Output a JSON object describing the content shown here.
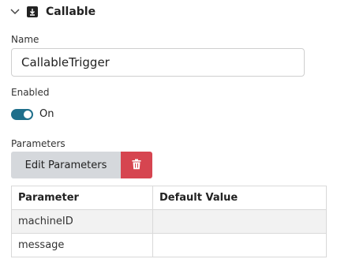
{
  "header": {
    "title": "Callable",
    "chevron_icon": "chevron-down-icon",
    "type_icon": "download-arrow-icon"
  },
  "name_field": {
    "label": "Name",
    "value": "CallableTrigger"
  },
  "enabled": {
    "label": "Enabled",
    "state_label": "On",
    "checked": true,
    "color": "#1f6f8b"
  },
  "parameters": {
    "label": "Parameters",
    "edit_button_label": "Edit Parameters",
    "delete_icon": "trash-icon",
    "delete_color": "#d64550",
    "columns": [
      "Parameter",
      "Default Value"
    ],
    "rows": [
      {
        "parameter": "machineID",
        "default_value": ""
      },
      {
        "parameter": "message",
        "default_value": ""
      }
    ]
  }
}
